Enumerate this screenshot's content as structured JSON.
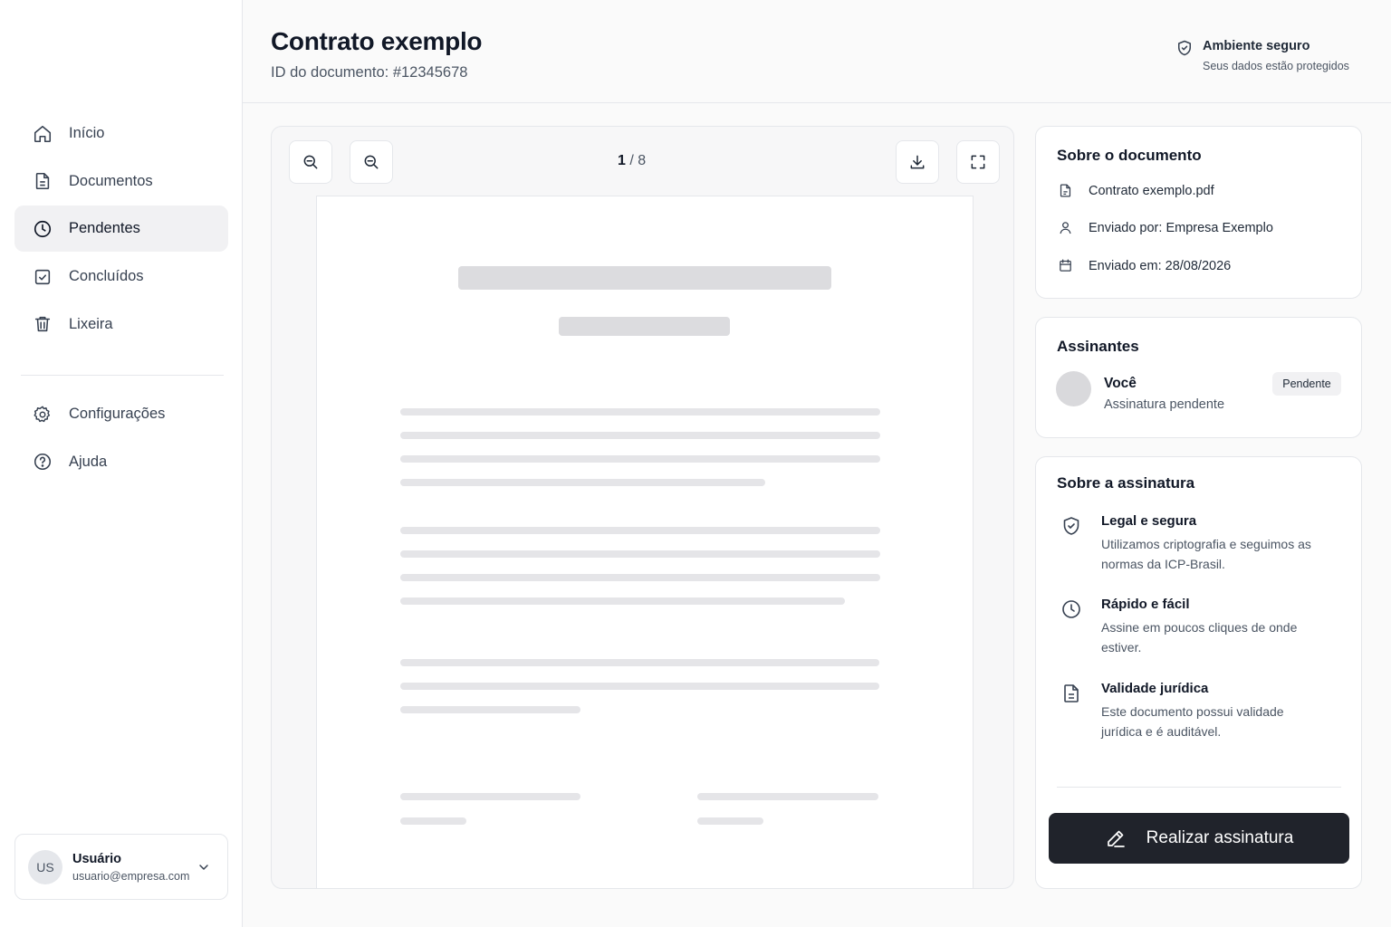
{
  "sidebar": {
    "nav": [
      {
        "label": "Início",
        "icon": "home-icon"
      },
      {
        "label": "Documentos",
        "icon": "document-icon"
      },
      {
        "label": "Pendentes",
        "icon": "clock-icon",
        "active": true
      },
      {
        "label": "Concluídos",
        "icon": "check-square-icon"
      },
      {
        "label": "Lixeira",
        "icon": "trash-icon"
      }
    ],
    "nav_secondary": [
      {
        "label": "Configurações",
        "icon": "gear-icon"
      },
      {
        "label": "Ajuda",
        "icon": "help-icon"
      }
    ],
    "user": {
      "initials": "US",
      "name": "Usuário",
      "email": "usuario@empresa.com"
    }
  },
  "header": {
    "title": "Contrato exemplo",
    "doc_id": "ID do documento: #12345678",
    "secure_title": "Ambiente seguro",
    "secure_subtitle": "Seus dados estão protegidos"
  },
  "viewer": {
    "current_page": "1",
    "page_separator": " / ",
    "total_pages": "8"
  },
  "about_document": {
    "title": "Sobre o documento",
    "file_name": "Contrato exemplo.pdf",
    "sent_by": "Enviado por: Empresa Exemplo",
    "sent_at": "Enviado em: 28/08/2026"
  },
  "signers": {
    "title": "Assinantes",
    "items": [
      {
        "name": "Você",
        "status": "Assinatura pendente",
        "badge": "Pendente"
      }
    ]
  },
  "about_signature": {
    "title": "Sobre a assinatura",
    "features": [
      {
        "title": "Legal e segura",
        "text": "Utilizamos criptografia e seguimos as normas da ICP-Brasil.",
        "icon": "shield-check-icon"
      },
      {
        "title": "Rápido e fácil",
        "text": "Assine em poucos cliques de onde estiver.",
        "icon": "clock-icon"
      },
      {
        "title": "Validade jurídica",
        "text": "Este documento possui validade jurídica e é auditável.",
        "icon": "document-icon"
      }
    ],
    "button_label": "Realizar assinatura"
  },
  "colors": {
    "primary_button": "#20232b",
    "active_nav_bg": "#f1f1f3",
    "placeholder_bar": "#e5e5e8"
  }
}
